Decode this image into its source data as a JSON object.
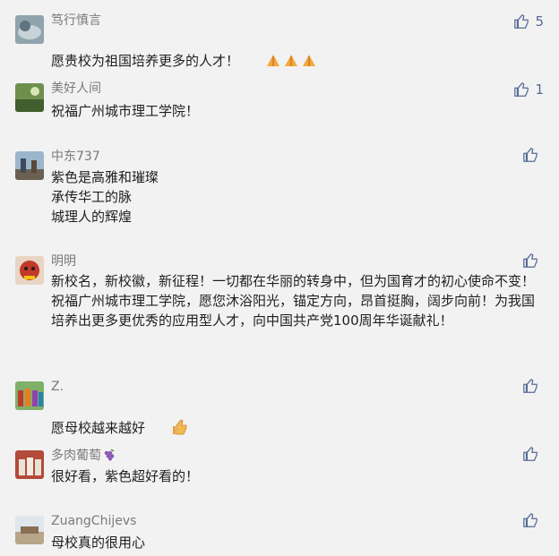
{
  "comments": [
    {
      "nick": "笃行慎言",
      "text": "愿贵校为祖国培养更多的人才！",
      "likes": "5",
      "emoji": "pray"
    },
    {
      "nick": "美好人间",
      "text": "祝福广州城市理工学院！",
      "likes": "1"
    },
    {
      "nick": "中东737",
      "text": "紫色是高雅和璀璨\n承传华工的脉\n城理人的辉煌",
      "likes": ""
    },
    {
      "nick": "明明",
      "text": "新校名，新校徽，新征程！一切都在华丽的转身中，但为国育才的初心使命不变！祝福广州城市理工学院，愿您沐浴阳光，锚定方向，昂首挺胸，阔步向前！为我国培养出更多更优秀的应用型人才，向中国共产党100周年华诞献礼！",
      "likes": ""
    },
    {
      "nick": "Z.",
      "text": "愿母校越来越好",
      "likes": "",
      "emoji": "thumb"
    },
    {
      "nick": "多肉葡萄",
      "text": "很好看，紫色超好看的！",
      "likes": "",
      "nick_icon": "grape-icon"
    },
    {
      "nick": "ZuangChijevs",
      "text": "母校真的很用心",
      "likes": ""
    }
  ],
  "colors": {
    "like_icon": "#576b95",
    "nick": "#7a7a7a",
    "text": "#1f1f1f",
    "background": "#f2f2f2"
  }
}
